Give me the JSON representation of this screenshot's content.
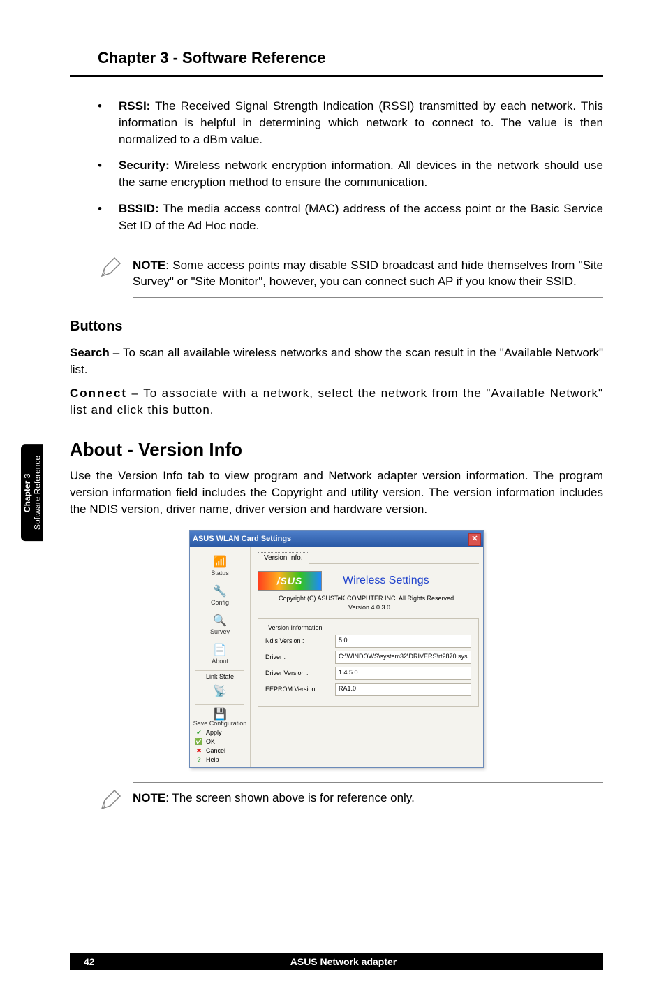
{
  "chapter_heading": "Chapter 3 - Software Reference",
  "bullets": [
    {
      "term": "RSSI:",
      "text": " The Received Signal Strength Indication (RSSI) transmitted by each network. This information is helpful in determining which network to connect to. The value is then normalized to a dBm value."
    },
    {
      "term": "Security:",
      "text": " Wireless network encryption information. All devices in the network should use the same encryption method to ensure the communication."
    },
    {
      "term": "BSSID:",
      "text": " The media access control (MAC) address of the access point or the Basic Service Set ID of the Ad Hoc node."
    }
  ],
  "note1_label": "NOTE",
  "note1_text": ": Some access points may disable SSID broadcast and hide themselves from \"Site Survey\" or \"Site Monitor\", however, you can connect such AP if you know their SSID.",
  "buttons_heading": "Buttons",
  "search_label": "Search",
  "search_text": " – To scan all available wireless networks and show the scan result in the \"Available Network\" list.",
  "connect_label": "Connect",
  "connect_text": " – To associate with a network, select the network from the \"Available Network\" list and click this button.",
  "about_heading": "About - Version Info",
  "about_text": "Use the Version Info tab to view program and Network adapter version information. The program version information field includes the Copyright and utility version. The version information includes the NDIS version, driver name, driver version and hardware version.",
  "dialog": {
    "title": "ASUS WLAN Card Settings",
    "nav": {
      "status": "Status",
      "config": "Config",
      "survey": "Survey",
      "about": "About",
      "linkstate": "Link State",
      "saveconfig": "Save Configuration",
      "apply": "Apply",
      "ok": "OK",
      "cancel": "Cancel",
      "help": "Help"
    },
    "tab": "Version Info.",
    "brand": "/SUS",
    "brand_text": "Wireless Settings",
    "copyright": "Copyright (C) ASUSTeK COMPUTER INC. All Rights Reserved.",
    "versionline": "Version 4.0.3.0",
    "legend": "Version Information",
    "rows": {
      "ndis_label": "Ndis Version :",
      "ndis_value": "5.0",
      "driver_label": "Driver :",
      "driver_value": "C:\\WINDOWS\\system32\\DRIVERS\\rt2870.sys",
      "dver_label": "Driver Version :",
      "dver_value": "1.4.5.0",
      "eeprom_label": "EEPROM Version :",
      "eeprom_value": "RA1.0"
    }
  },
  "note2_label": "NOTE",
  "note2_text": ": The screen shown above is for reference only.",
  "side_tab_line1": "Chapter 3",
  "side_tab_line2": "Software Reference",
  "footer_page": "42",
  "footer_text": "ASUS Network adapter"
}
